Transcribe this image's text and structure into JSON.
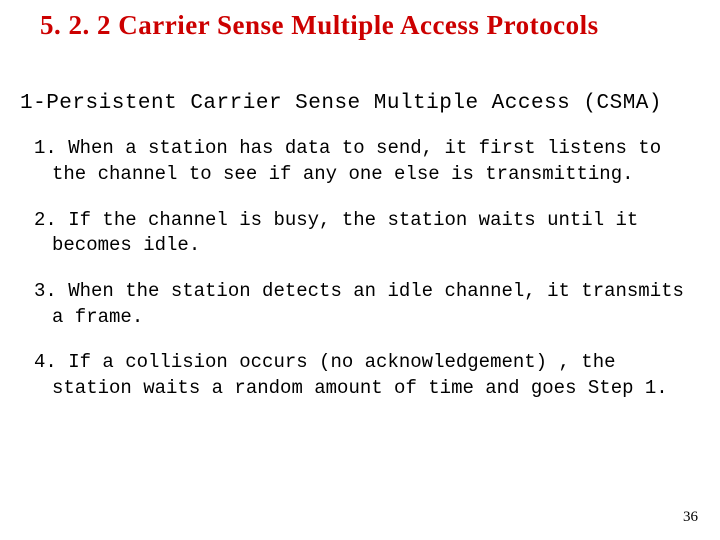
{
  "title": "5. 2. 2 Carrier Sense Multiple Access Protocols",
  "subheading": "1-Persistent Carrier Sense Multiple Access (CSMA)",
  "points": [
    "1. When a station has data to send, it first listens to the channel to see if any one else is transmitting.",
    "2. If the channel is busy, the station waits until it becomes idle.",
    "3. When the station detects an idle channel, it transmits a frame.",
    "4. If a collision occurs (no acknowledgement) , the station waits a random amount of time and goes Step 1."
  ],
  "page_number": "36"
}
